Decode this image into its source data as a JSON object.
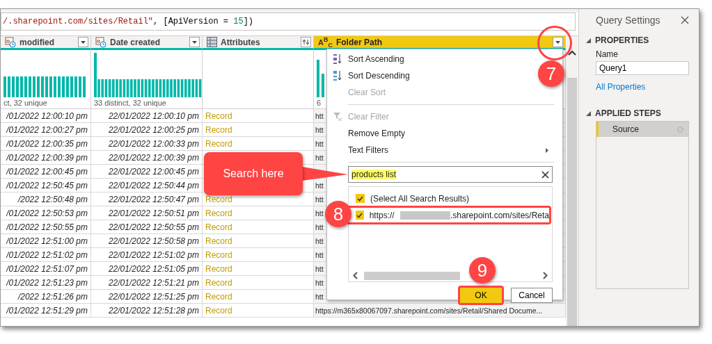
{
  "formula_bar": {
    "parts": [
      {
        "kind": "string",
        "text": "/.sharepoint.com/sites/Retail\""
      },
      {
        "kind": "plain",
        "text": ", [ApiVersion = "
      },
      {
        "kind": "number",
        "text": "15"
      },
      {
        "kind": "plain",
        "text": "])"
      }
    ]
  },
  "table": {
    "columns": [
      {
        "header": "modified",
        "profile": "ct, 32 unique",
        "selected": false
      },
      {
        "header": "Date created",
        "profile": "33 distinct, 32 unique",
        "selected": false
      },
      {
        "header": "Attributes",
        "selected": false
      },
      {
        "header": "Folder Path",
        "type_label": "A$^{B}$$_{C}$",
        "profile": "6",
        "selected": true
      }
    ],
    "rows": [
      {
        "modified": "/01/2022 12:00:10 pm",
        "created": "22/01/2022 12:00:10 pm",
        "attributes": "Record",
        "folder_path": "htt"
      },
      {
        "modified": "/01/2022 12:00:27 pm",
        "created": "22/01/2022 12:00:25 pm",
        "attributes": "Record",
        "folder_path": "htt"
      },
      {
        "modified": "/01/2022 12:00:35 pm",
        "created": "22/01/2022 12:00:33 pm",
        "attributes": "Record",
        "folder_path": "htt"
      },
      {
        "modified": "/01/2022 12:00:39 pm",
        "created": "22/01/2022 12:00:39 pm",
        "folder_path": "htt"
      },
      {
        "modified": "/01/2022 12:00:45 pm",
        "created": "22/01/2022 12:00:45 pm"
      },
      {
        "modified": "/01/2022 12:50:45 pm",
        "created": "22/01/2022 12:50:44 pm",
        "folder_path": "htt"
      },
      {
        "modified": "/2022 12:50:48 pm",
        "created": "22/01/2022 12:50:47 pm",
        "attributes": "Record",
        "folder_path": "htt"
      },
      {
        "modified": "/01/2022 12:50:53 pm",
        "created": "22/01/2022 12:50:51 pm",
        "attributes": "Record",
        "folder_path": "htt"
      },
      {
        "modified": "/01/2022 12:50:55 pm",
        "created": "22/01/2022 12:50:55 pm",
        "attributes": "Record",
        "folder_path": "htt"
      },
      {
        "modified": "/01/2022 12:51:00 pm",
        "created": "22/01/2022 12:50:58 pm",
        "attributes": "Record",
        "folder_path": "htt"
      },
      {
        "modified": "/01/2022 12:51:02 pm",
        "created": "22/01/2022 12:51:02 pm",
        "attributes": "Record",
        "folder_path": "htt"
      },
      {
        "modified": "/01/2022 12:51:07 pm",
        "created": "22/01/2022 12:51:05 pm",
        "attributes": "Record",
        "folder_path": "htt"
      },
      {
        "modified": "/01/2022 12:51:23 pm",
        "created": "22/01/2022 12:51:21 pm",
        "attributes": "Record",
        "folder_path": "htt"
      },
      {
        "modified": "/2022 12:51:26 pm",
        "created": "22/01/2022 12:51:25 pm",
        "attributes": "Record",
        "folder_path": "htt"
      },
      {
        "modified": "/01/2022 12:51:29 pm",
        "created": "22/01/2022 12:51:28 pm",
        "attributes": "Record",
        "folder_path": "https://m365x80067097.sharepoint.com/sites/Retail/Shared Docume..."
      }
    ]
  },
  "filter_menu": {
    "items": [
      {
        "kind": "item",
        "label": "Sort Ascending",
        "disabled": false
      },
      {
        "kind": "item",
        "label": "Sort Descending",
        "disabled": false
      },
      {
        "kind": "item",
        "label": "Clear Sort",
        "disabled": true
      },
      {
        "kind": "divider"
      },
      {
        "kind": "item",
        "label": "Clear Filter",
        "disabled": true
      },
      {
        "kind": "item",
        "label": "Remove Empty",
        "disabled": false
      },
      {
        "kind": "submenu",
        "label": "Text Filters",
        "disabled": false
      },
      {
        "kind": "divider"
      }
    ],
    "search": {
      "value": "products list"
    },
    "values": [
      {
        "label": "(Select All Search Results)",
        "checked": true
      },
      {
        "label": "https://",
        "label_after": ".sharepoint.com/sites/Reta",
        "redacted": true,
        "checked": true
      }
    ],
    "buttons": [
      {
        "label": "OK",
        "primary": true
      },
      {
        "label": "Cancel",
        "primary": false
      }
    ]
  },
  "annotations": {
    "callout": "Search here",
    "steps": [
      "7",
      "8",
      "9"
    ]
  },
  "query_settings": {
    "title": "Query Settings",
    "properties_heading": "PROPERTIES",
    "name_label": "Name",
    "name_value": "Query1",
    "link": "All Properties",
    "steps_heading": "APPLIED STEPS",
    "steps": [
      {
        "label": "Source",
        "selected": true
      }
    ]
  }
}
